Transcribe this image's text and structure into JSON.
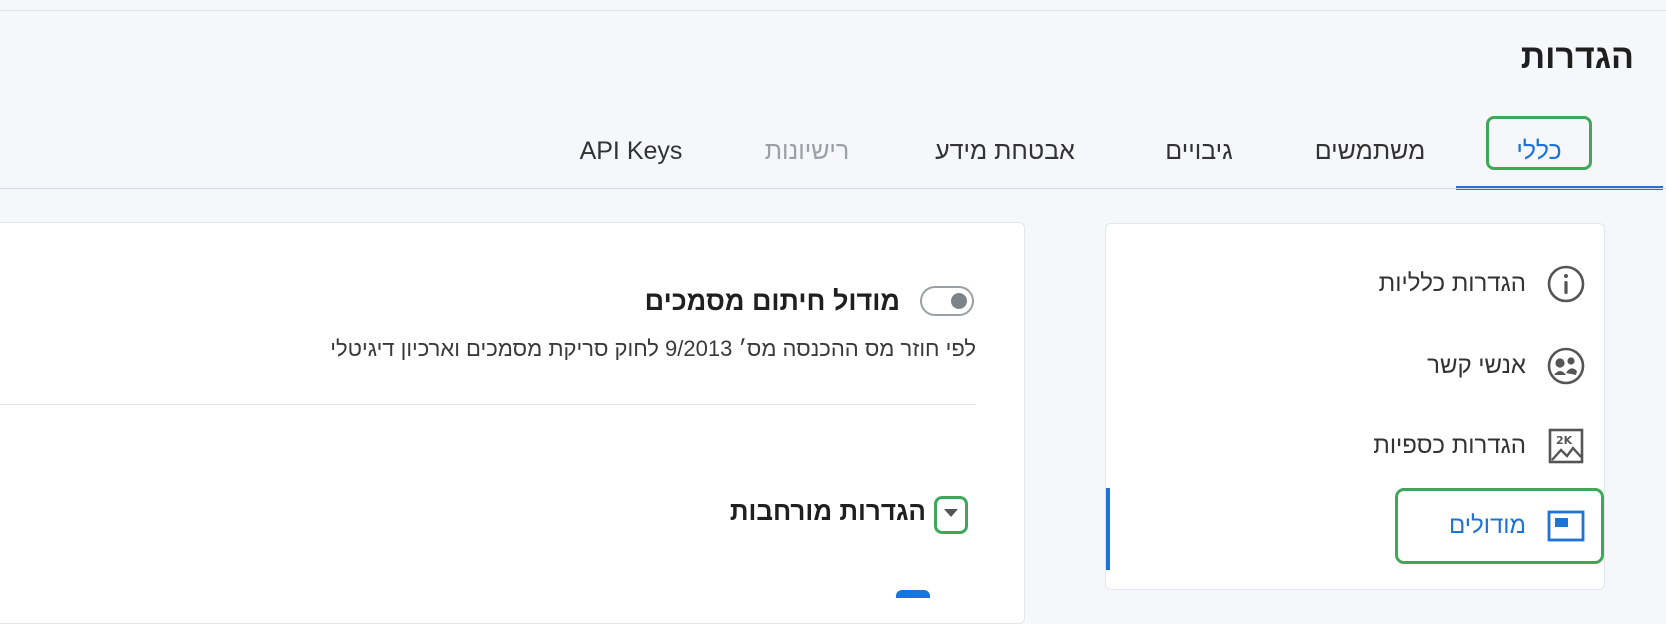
{
  "page_title": "הגדרות",
  "tabs": [
    {
      "label": "כללי",
      "state": "active"
    },
    {
      "label": "משתמשים",
      "state": "normal"
    },
    {
      "label": "גיבויים",
      "state": "normal"
    },
    {
      "label": "אבטחת מידע",
      "state": "normal"
    },
    {
      "label": "רישיונות",
      "state": "disabled"
    },
    {
      "label": "API Keys",
      "state": "normal"
    }
  ],
  "sidebar": {
    "items": [
      {
        "label": "הגדרות כלליות",
        "icon": "info-icon"
      },
      {
        "label": "אנשי קשר",
        "icon": "contacts-icon"
      },
      {
        "label": "הגדרות כספיות",
        "icon": "finance-icon"
      },
      {
        "label": "מודולים",
        "icon": "modules-icon",
        "active": true
      }
    ]
  },
  "main": {
    "module": {
      "title": "מודול חיתום מסמכים",
      "description": "לפי חוזר מס ההכנסה מס׳ 9/2013 לחוק סריקת מסמכים וארכיון דיגיטלי",
      "enabled": false
    },
    "advanced": {
      "title": "הגדרות מורחבות",
      "expanded": false,
      "icon": "caret-down-icon"
    }
  },
  "colors": {
    "accent": "#1d73d6",
    "highlight": "#3ea85a",
    "background": "#f5f7fa"
  }
}
